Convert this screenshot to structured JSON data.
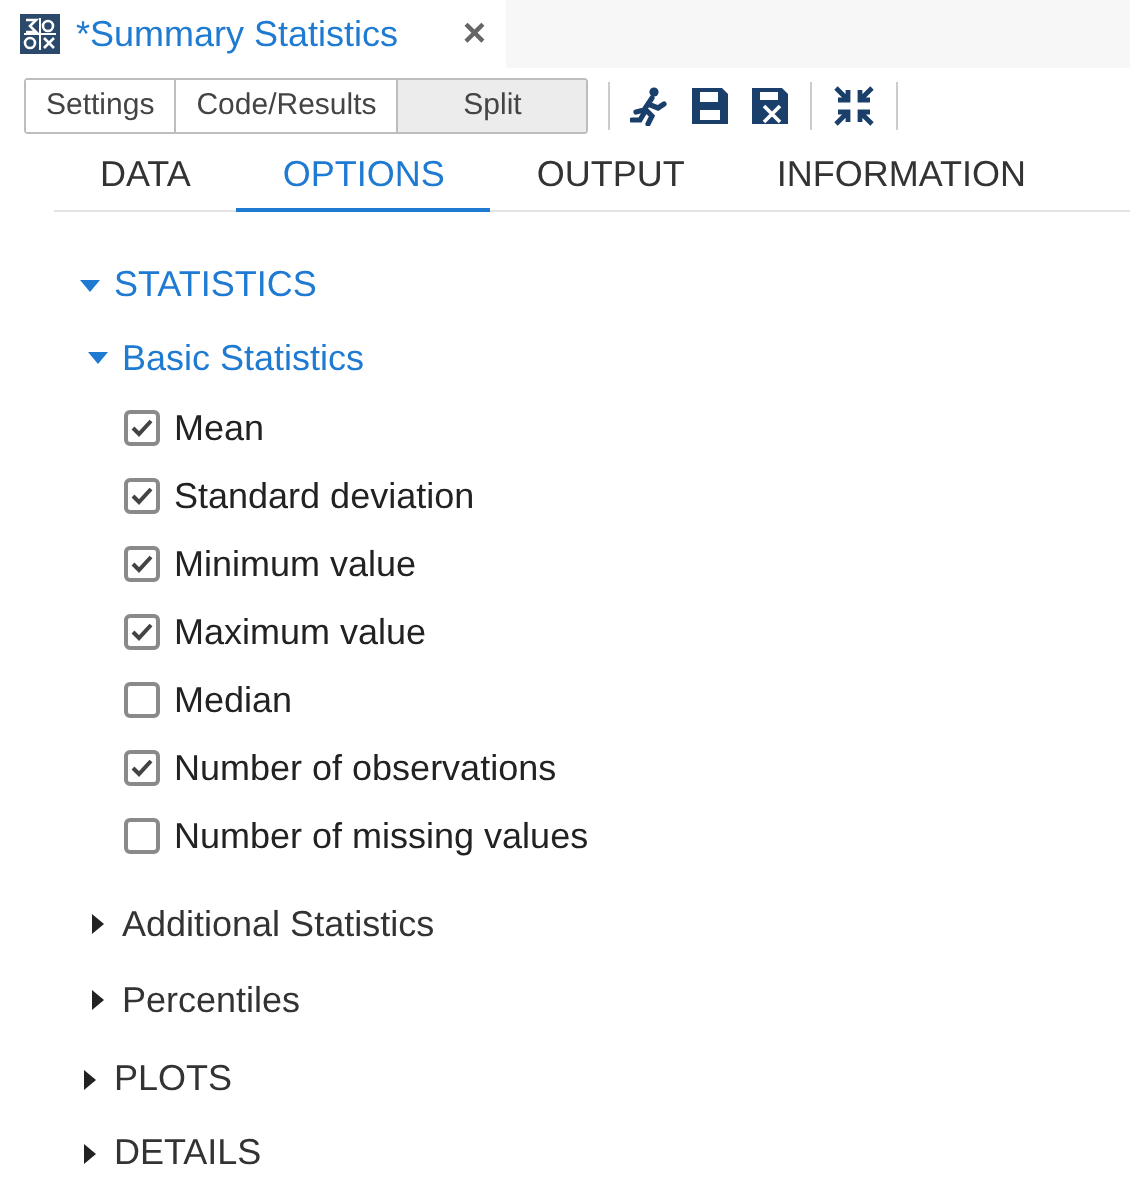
{
  "document_tab": {
    "title": "*Summary Statistics",
    "close": "×"
  },
  "view_buttons": [
    {
      "label": "Settings",
      "selected": false
    },
    {
      "label": "Code/Results",
      "selected": false
    },
    {
      "label": "Split",
      "selected": true
    }
  ],
  "tabs": [
    {
      "label": "DATA",
      "selected": false
    },
    {
      "label": "OPTIONS",
      "selected": true
    },
    {
      "label": "OUTPUT",
      "selected": false
    },
    {
      "label": "INFORMATION",
      "selected": false
    }
  ],
  "sections": [
    {
      "label": "STATISTICS",
      "expanded": true,
      "children": [
        {
          "kind": "group",
          "label": "Basic Statistics",
          "expanded": true,
          "children": [
            {
              "kind": "checkbox",
              "label": "Mean",
              "checked": true
            },
            {
              "kind": "checkbox",
              "label": "Standard deviation",
              "checked": true
            },
            {
              "kind": "checkbox",
              "label": "Minimum value",
              "checked": true
            },
            {
              "kind": "checkbox",
              "label": "Maximum value",
              "checked": true
            },
            {
              "kind": "checkbox",
              "label": "Median",
              "checked": false
            },
            {
              "kind": "checkbox",
              "label": "Number of observations",
              "checked": true
            },
            {
              "kind": "checkbox",
              "label": "Number of missing values",
              "checked": false
            }
          ]
        },
        {
          "kind": "group",
          "label": "Additional Statistics",
          "expanded": false
        },
        {
          "kind": "group",
          "label": "Percentiles",
          "expanded": false
        }
      ]
    },
    {
      "label": "PLOTS",
      "expanded": false
    },
    {
      "label": "DETAILS",
      "expanded": false
    }
  ]
}
